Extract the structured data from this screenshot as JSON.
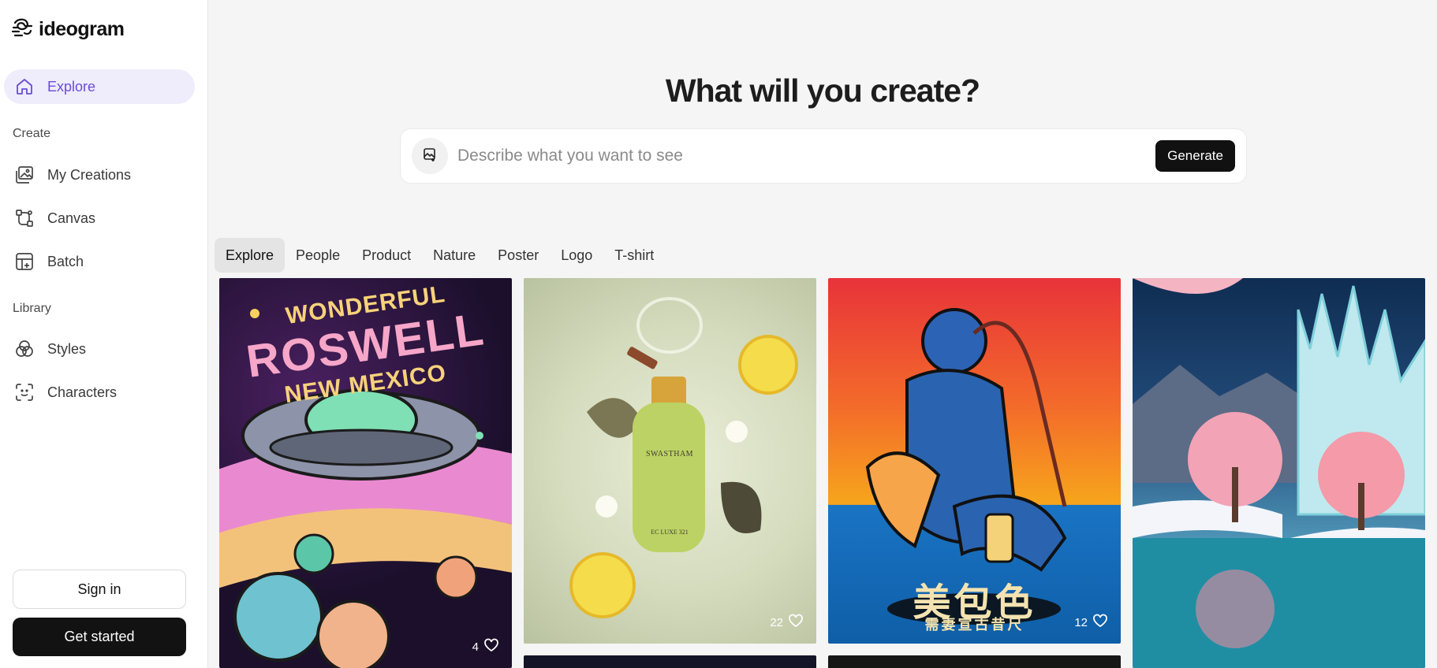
{
  "brand": {
    "name": "ideogram",
    "logo_icon": "ideogram-logo-icon"
  },
  "sidebar": {
    "explore": {
      "label": "Explore",
      "icon": "home-icon"
    },
    "create_section": "Create",
    "create_items": [
      {
        "label": "My Creations",
        "icon": "images-icon"
      },
      {
        "label": "Canvas",
        "icon": "canvas-icon"
      },
      {
        "label": "Batch",
        "icon": "batch-icon"
      }
    ],
    "library_section": "Library",
    "library_items": [
      {
        "label": "Styles",
        "icon": "styles-icon"
      },
      {
        "label": "Characters",
        "icon": "characters-icon"
      }
    ],
    "sign_in": "Sign in",
    "get_started": "Get started"
  },
  "hero": {
    "title": "What will you create?",
    "placeholder": "Describe what you want to see",
    "generate": "Generate"
  },
  "tabs": [
    "Explore",
    "People",
    "Product",
    "Nature",
    "Poster",
    "Logo",
    "T-shirt"
  ],
  "gallery": {
    "tile1": {
      "line1": "WONDERFUL",
      "line2": "ROSWELL",
      "line3": "NEW MEXICO",
      "likes": "4"
    },
    "tile2": {
      "bottle_brand": "SWASTHAM",
      "bottle_sub": "EC LUXE 321",
      "likes": "22"
    },
    "tile3": {
      "caption_cjk": "美包色",
      "caption_sub": "需妻宣古昔尺",
      "likes": "12"
    }
  },
  "colors": {
    "accent": "#6a4cd6",
    "active_bg": "#efecfb",
    "dark_button": "#121212"
  }
}
